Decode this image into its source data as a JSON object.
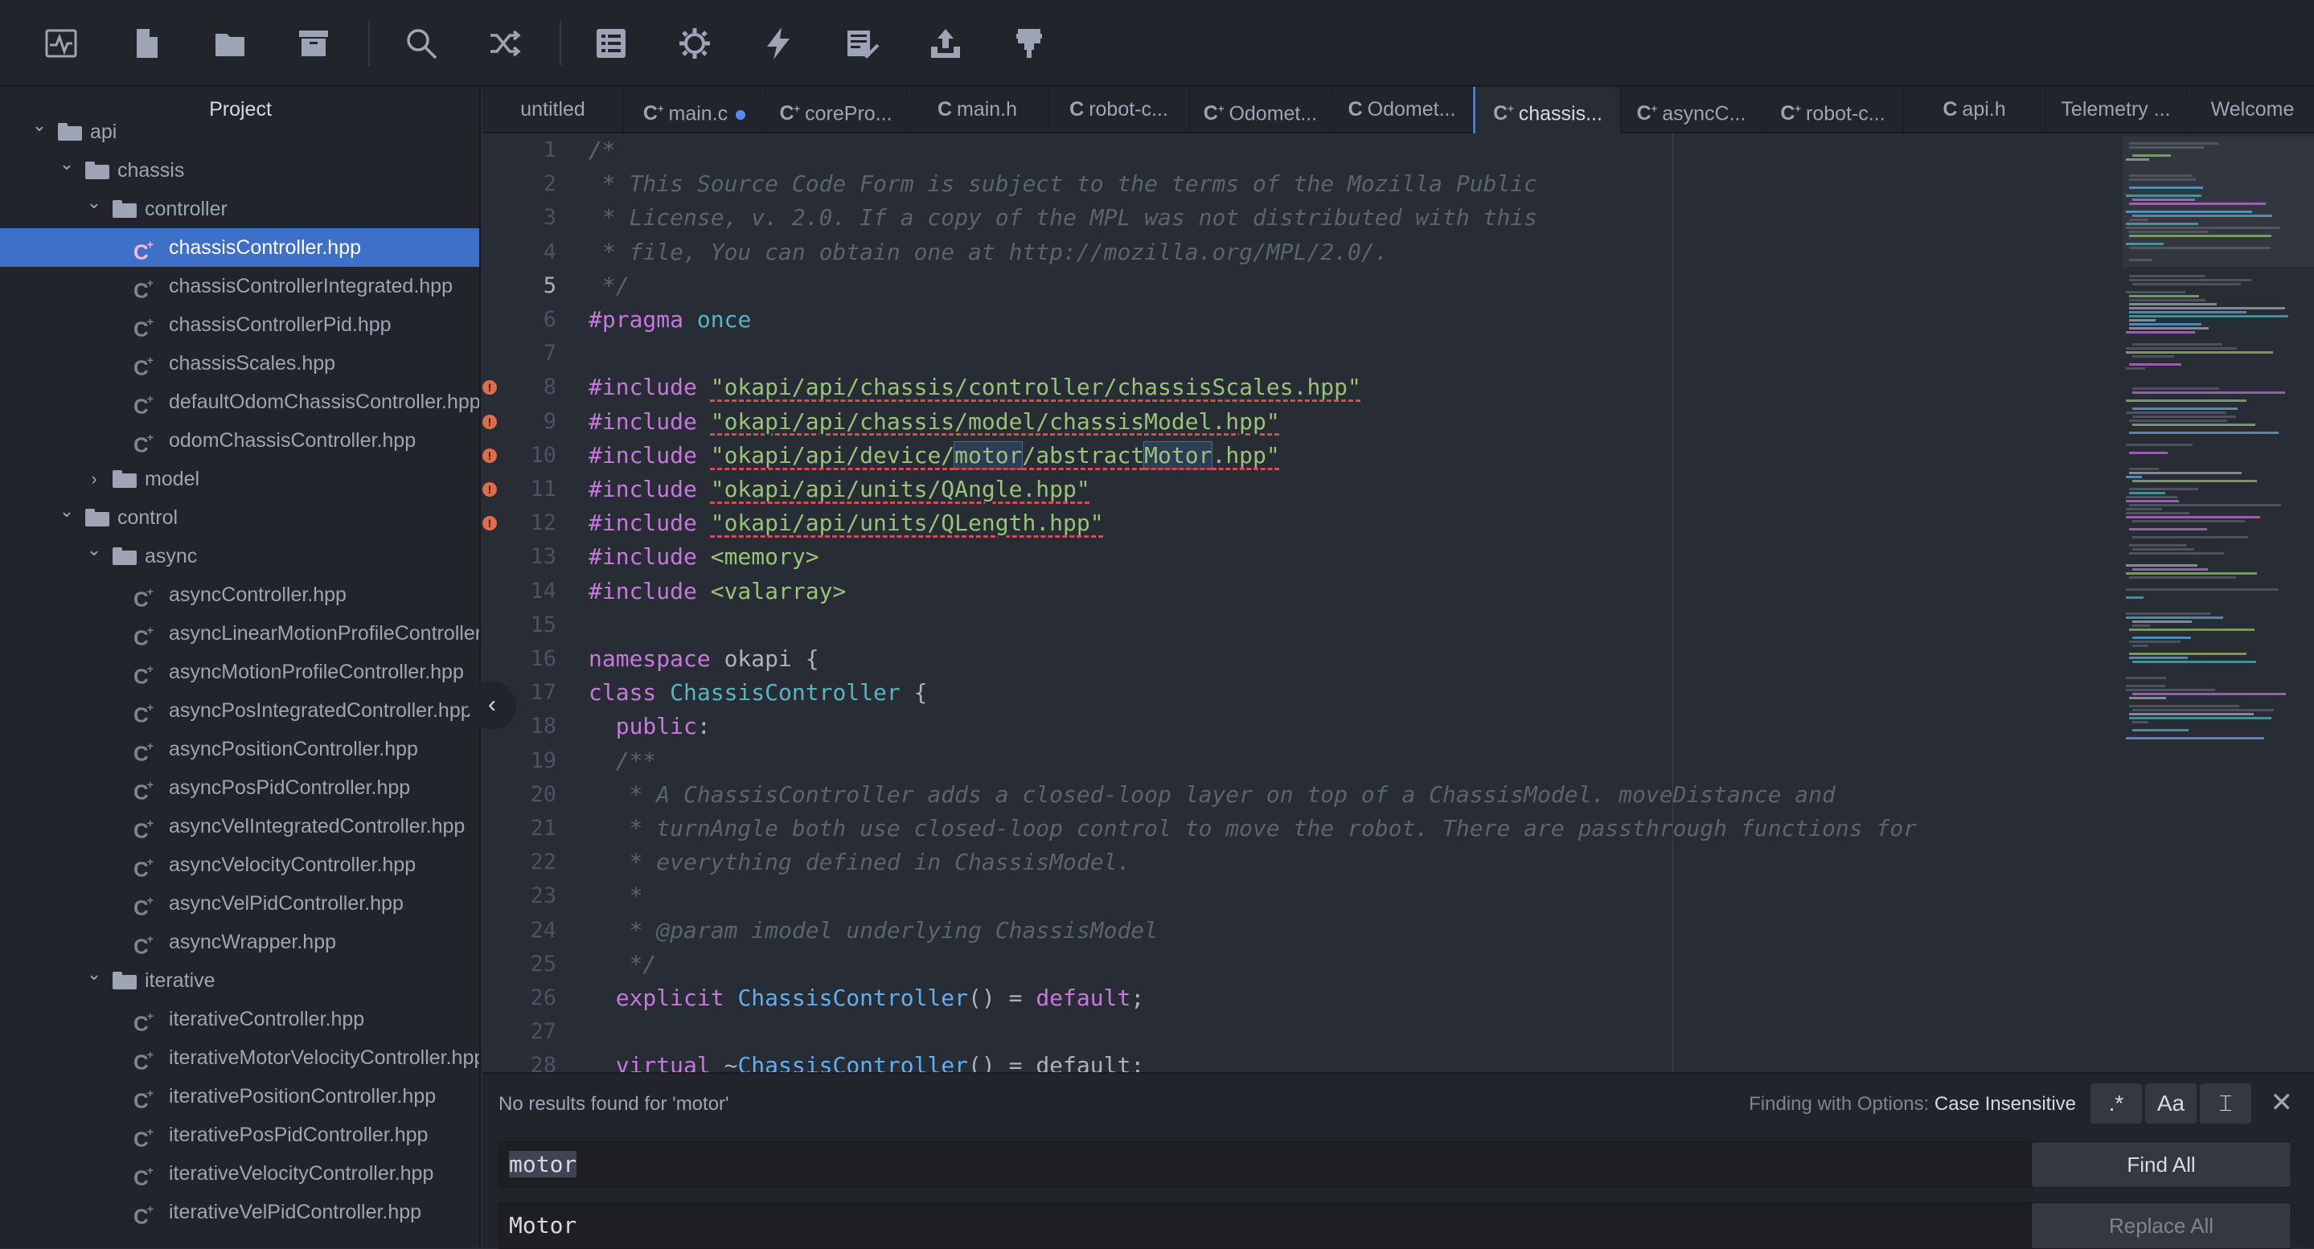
{
  "toolbar": {
    "icons": [
      "pulse-icon",
      "new-file-icon",
      "folder-icon",
      "archive-icon",
      "search-icon",
      "shuffle-icon",
      "list-icon",
      "gear-icon",
      "lightning-icon",
      "checklist-icon",
      "upload-icon",
      "plug-icon"
    ]
  },
  "sidebar": {
    "title": "Project",
    "rows": [
      {
        "label": "api",
        "type": "folder",
        "expanded": true,
        "depth": 0
      },
      {
        "label": "chassis",
        "type": "folder",
        "expanded": true,
        "depth": 1
      },
      {
        "label": "controller",
        "type": "folder",
        "expanded": true,
        "depth": 2
      },
      {
        "label": "chassisController.hpp",
        "type": "file",
        "depth": 3,
        "selected": true
      },
      {
        "label": "chassisControllerIntegrated.hpp",
        "type": "file",
        "depth": 3
      },
      {
        "label": "chassisControllerPid.hpp",
        "type": "file",
        "depth": 3
      },
      {
        "label": "chassisScales.hpp",
        "type": "file",
        "depth": 3
      },
      {
        "label": "defaultOdomChassisController.hpp",
        "type": "file",
        "depth": 3
      },
      {
        "label": "odomChassisController.hpp",
        "type": "file",
        "depth": 3
      },
      {
        "label": "model",
        "type": "folder",
        "expanded": false,
        "depth": 2
      },
      {
        "label": "control",
        "type": "folder",
        "expanded": true,
        "depth": 1
      },
      {
        "label": "async",
        "type": "folder",
        "expanded": true,
        "depth": 2
      },
      {
        "label": "asyncController.hpp",
        "type": "file",
        "depth": 3
      },
      {
        "label": "asyncLinearMotionProfileController.hpp",
        "type": "file",
        "depth": 3
      },
      {
        "label": "asyncMotionProfileController.hpp",
        "type": "file",
        "depth": 3
      },
      {
        "label": "asyncPosIntegratedController.hpp",
        "type": "file",
        "depth": 3
      },
      {
        "label": "asyncPositionController.hpp",
        "type": "file",
        "depth": 3
      },
      {
        "label": "asyncPosPidController.hpp",
        "type": "file",
        "depth": 3
      },
      {
        "label": "asyncVelIntegratedController.hpp",
        "type": "file",
        "depth": 3
      },
      {
        "label": "asyncVelocityController.hpp",
        "type": "file",
        "depth": 3
      },
      {
        "label": "asyncVelPidController.hpp",
        "type": "file",
        "depth": 3
      },
      {
        "label": "asyncWrapper.hpp",
        "type": "file",
        "depth": 3
      },
      {
        "label": "iterative",
        "type": "folder",
        "expanded": true,
        "depth": 2
      },
      {
        "label": "iterativeController.hpp",
        "type": "file",
        "depth": 3
      },
      {
        "label": "iterativeMotorVelocityController.hpp",
        "type": "file",
        "depth": 3
      },
      {
        "label": "iterativePositionController.hpp",
        "type": "file",
        "depth": 3
      },
      {
        "label": "iterativePosPidController.hpp",
        "type": "file",
        "depth": 3
      },
      {
        "label": "iterativeVelocityController.hpp",
        "type": "file",
        "depth": 3
      },
      {
        "label": "iterativeVelPidController.hpp",
        "type": "file",
        "depth": 3
      }
    ],
    "file_icon": "C",
    "file_icon_plus": "+"
  },
  "tabs": [
    {
      "label": "untitled",
      "icon": ""
    },
    {
      "label": "main.c",
      "icon": "C+",
      "modified": true
    },
    {
      "label": "corePro...",
      "icon": "C+"
    },
    {
      "label": "main.h",
      "icon": "C"
    },
    {
      "label": "robot-c...",
      "icon": "C"
    },
    {
      "label": "Odomet...",
      "icon": "C+"
    },
    {
      "label": "Odomet...",
      "icon": "C"
    },
    {
      "label": "chassis...",
      "icon": "C+",
      "active": true
    },
    {
      "label": "asyncC...",
      "icon": "C+"
    },
    {
      "label": "robot-c...",
      "icon": "C+"
    },
    {
      "label": "api.h",
      "icon": "C"
    },
    {
      "label": "Telemetry ...",
      "icon": ""
    },
    {
      "label": "Welcome",
      "icon": ""
    }
  ],
  "editor": {
    "current_line": 5,
    "lines": [
      [
        [
          "c-com",
          "/*"
        ]
      ],
      [
        [
          "c-com",
          " * This Source Code Form is subject to the terms of the Mozilla Public"
        ]
      ],
      [
        [
          "c-com",
          " * License, v. 2.0. If a copy of the MPL was not distributed with this"
        ]
      ],
      [
        [
          "c-com",
          " * file, You can obtain one at http://mozilla.org/MPL/2.0/."
        ]
      ],
      [
        [
          "c-com",
          " */"
        ]
      ],
      [
        [
          "c-pp",
          "#pragma"
        ],
        [
          "",
          ""
        ],
        [
          "c-cls",
          " once"
        ]
      ],
      [],
      [
        [
          "c-pp",
          "#include"
        ],
        [
          "",
          " "
        ],
        [
          "c-str",
          "\"okapi/api/chassis/controller/chassisScales.hpp\""
        ]
      ],
      [
        [
          "c-pp",
          "#include"
        ],
        [
          "",
          " "
        ],
        [
          "c-str",
          "\"okapi/api/chassis/model/chassisModel.hpp\""
        ]
      ],
      [
        [
          "c-pp",
          "#include"
        ],
        [
          "",
          " "
        ],
        [
          "c-str",
          "\"okapi/api/device/"
        ],
        [
          "c-str c-mark",
          "motor"
        ],
        [
          "c-str",
          "/abstract"
        ],
        [
          "c-str c-mark",
          "Motor"
        ],
        [
          "c-str",
          ".hpp\""
        ]
      ],
      [
        [
          "c-pp",
          "#include"
        ],
        [
          "",
          " "
        ],
        [
          "c-str",
          "\"okapi/api/units/QAngle.hpp\""
        ]
      ],
      [
        [
          "c-pp",
          "#include"
        ],
        [
          "",
          " "
        ],
        [
          "c-str",
          "\"okapi/api/units/QLength.hpp\""
        ]
      ],
      [
        [
          "c-pp",
          "#include"
        ],
        [
          "",
          " "
        ],
        [
          "c-tag",
          "<memory>"
        ]
      ],
      [
        [
          "c-pp",
          "#include"
        ],
        [
          "",
          " "
        ],
        [
          "c-tag",
          "<valarray>"
        ]
      ],
      [],
      [
        [
          "c-kw",
          "namespace"
        ],
        [
          "",
          " okapi {"
        ]
      ],
      [
        [
          "c-kw",
          "class"
        ],
        [
          "",
          " "
        ],
        [
          "c-cls",
          "ChassisController"
        ],
        [
          "",
          " {"
        ]
      ],
      [
        [
          "",
          " "
        ],
        [
          "c-kw",
          " public"
        ],
        [
          "",
          ":"
        ]
      ],
      [
        [
          "c-com",
          "  /**"
        ]
      ],
      [
        [
          "c-com",
          "   * A ChassisController adds a closed-loop layer on top of a ChassisModel. moveDistance and"
        ]
      ],
      [
        [
          "c-com",
          "   * turnAngle both use closed-loop control to move the robot. There are passthrough functions for"
        ]
      ],
      [
        [
          "c-com",
          "   * everything defined in ChassisModel."
        ]
      ],
      [
        [
          "c-com",
          "   *"
        ]
      ],
      [
        [
          "c-com",
          "   * @param imodel underlying ChassisModel"
        ]
      ],
      [
        [
          "c-com",
          "   */"
        ]
      ],
      [
        [
          "",
          "  "
        ],
        [
          "c-kw",
          "explicit"
        ],
        [
          "",
          " "
        ],
        [
          "c-fn",
          "ChassisController"
        ],
        [
          "",
          "() = "
        ],
        [
          "c-kw",
          "default"
        ],
        [
          "",
          ";"
        ]
      ],
      [],
      [
        [
          "",
          "  "
        ],
        [
          "c-kw",
          "virtual"
        ],
        [
          "",
          " ~"
        ],
        [
          "c-fn",
          "ChassisController"
        ],
        [
          "",
          "() = default;"
        ]
      ]
    ]
  },
  "error_lines": [
    8,
    9,
    10,
    11,
    12
  ],
  "error_mark": "!",
  "find": {
    "status": "No results found for 'motor'",
    "options_prefix": "Finding with Options:",
    "options_value": "Case Insensitive",
    "regex_label": ".*",
    "case_label": "Aa",
    "whole_word_label": "⌶",
    "close_label": "✕",
    "find_value": "motor",
    "replace_value": "Motor",
    "find_all_label": "Find All",
    "replace_all_label": "Replace All"
  },
  "collapse_glyph": "‹",
  "chevron_open": "⌄",
  "chevron_closed": "›",
  "colors": {
    "accent": "#3e6fc9",
    "error": "#e06c4a",
    "modified_dot": "#568af2"
  }
}
